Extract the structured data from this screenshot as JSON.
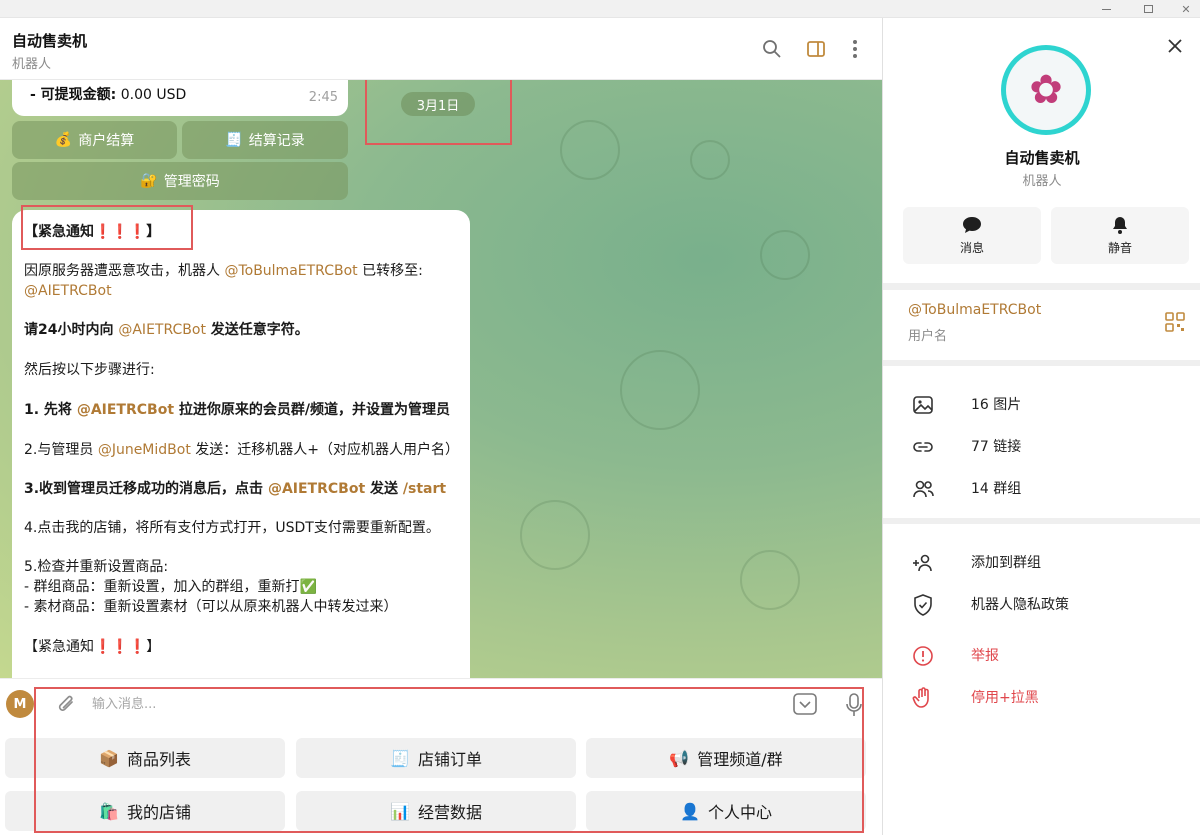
{
  "window": {
    "controls": [
      "minimize",
      "maximize",
      "close"
    ]
  },
  "header": {
    "title": "自动售卖机",
    "subtitle": "机器人"
  },
  "chat": {
    "previous_message": {
      "label": "- 可提现金额:",
      "value": "0.00 USD",
      "time": "2:45"
    },
    "inline_keyboard": [
      {
        "emoji": "💰",
        "label": "商户结算"
      },
      {
        "emoji": "🧾",
        "label": "结算记录"
      },
      {
        "emoji": "🔐",
        "label": "管理密码"
      }
    ],
    "date_pill": "3月1日",
    "message": {
      "heading": "【紧急通知",
      "heading_marks": "❗❗❗",
      "heading_close": "】",
      "line1_a": "因原服务器遭恶意攻击，机器人 ",
      "line1_mention": "@ToBulmaETRCBot",
      "line1_b": " 已转移至:",
      "line2_mention": "@AIETRCBot",
      "line3_a": "请24小时内向 ",
      "line3_mention": "@AIETRCBot",
      "line3_b": "  发送任意字符。",
      "line4": "然后按以下步骤进行:",
      "step1_a": "1. 先将 ",
      "step1_mention": "@AIETRCBot",
      "step1_b": "  拉进你原来的会员群/频道，并设置为管理员",
      "step2_a": "2.与管理员 ",
      "step2_mention": "@JuneMidBot",
      "step2_b": " 发送：迁移机器人+（对应机器人用户名）",
      "step3_a": "3.收到管理员迁移成功的消息后，点击 ",
      "step3_mention": "@AIETRCBot",
      "step3_b": "   发送 ",
      "step3_cmd": "/start",
      "step4": "4.点击我的店铺，将所有支付方式打开，USDT支付需要重新配置。",
      "step5": "5.检查并重新设置商品:",
      "step5_a": "- 群组商品：重新设置，加入的群组，重新打✅",
      "step5_b": "- 素材商品：重新设置素材（可以从原来机器人中转发过来）",
      "footer": "【紧急通知",
      "footer_marks": "❗❗❗",
      "footer_close": "】"
    }
  },
  "input": {
    "avatar_letter": "M",
    "placeholder": "输入消息..."
  },
  "reply_keyboard": [
    {
      "emoji": "📦",
      "label": "商品列表"
    },
    {
      "emoji": "🧾",
      "label": "店铺订单"
    },
    {
      "emoji": "📢",
      "label": "管理频道/群"
    },
    {
      "emoji": "🛍️",
      "label": "我的店铺"
    },
    {
      "emoji": "📊",
      "label": "经营数据"
    },
    {
      "emoji": "👤",
      "label": "个人中心"
    }
  ],
  "profile": {
    "name": "自动售卖机",
    "type": "机器人",
    "actions": [
      {
        "icon": "chat-bubble-icon",
        "label": "消息"
      },
      {
        "icon": "bell-icon",
        "label": "静音"
      }
    ],
    "username": "@ToBulmaETRCBot",
    "username_caption": "用户名",
    "media": [
      {
        "icon": "image-icon",
        "label": "16 图片"
      },
      {
        "icon": "link-icon",
        "label": "77 链接"
      },
      {
        "icon": "group-icon",
        "label": "14 群组"
      }
    ],
    "options": [
      {
        "icon": "add-user-icon",
        "label": "添加到群组"
      },
      {
        "icon": "shield-icon",
        "label": "机器人隐私政策"
      }
    ],
    "danger": [
      {
        "icon": "warning-icon",
        "label": "举报"
      },
      {
        "icon": "hand-icon",
        "label": "停用+拉黑"
      }
    ]
  },
  "colors": {
    "mention": "#b07a35",
    "danger": "#e0474c",
    "highlight": "#e05a5a",
    "avatar_ring": "#2ed4d0"
  }
}
